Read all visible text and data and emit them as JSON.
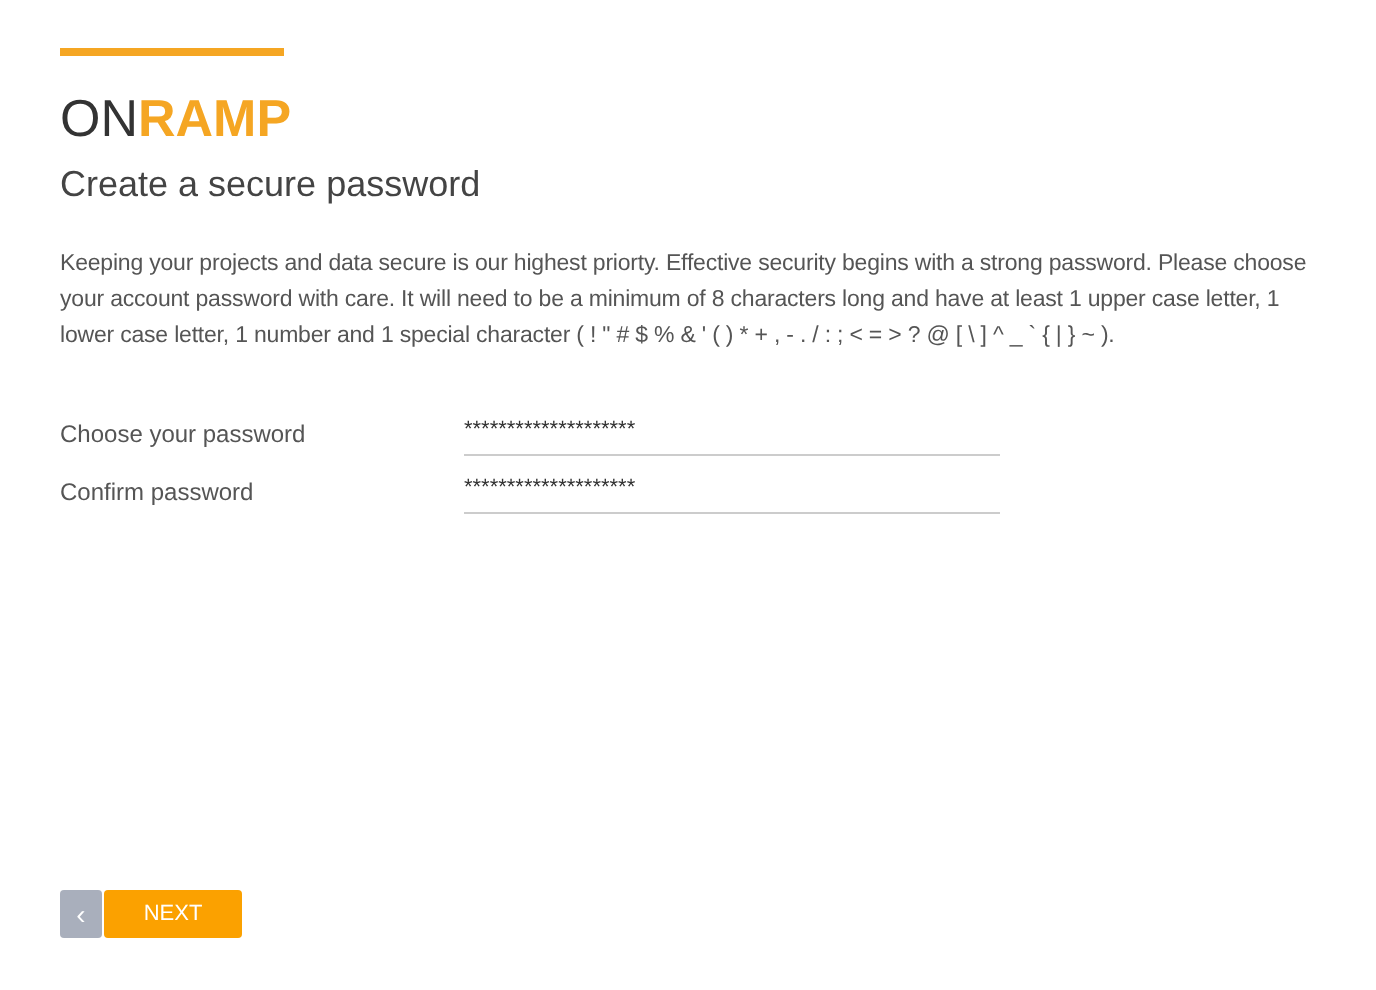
{
  "logo": "ON**RAMP**",
  "heading": "Create a secure password",
  "intro": "Keeping your projects and data secure is our highest priorty. Effective security begins with a strong password. Please choose your account password with care. It will need to be a minimum of 8 characters long and have at least 1 upper case letter, 1 lower case letter, 1 number and 1 special character ( ! \" # $ % & ' ( ) * + , - . / : ; < = > ? @ [ \\ ] ^ _ ` { | } ~ ).",
  "fields": [
    {
      "label": "Choose your password",
      "value": "********************"
    },
    {
      "label": "Confirm password",
      "value": "********************"
    }
  ],
  "back_button": {
    "label": "‹",
    "disabled": true
  },
  "next_button": {
    "label": "NEXT"
  }
}
